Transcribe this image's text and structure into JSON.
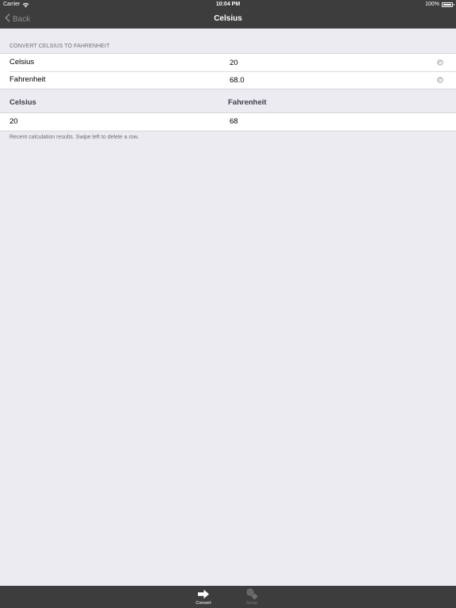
{
  "status_bar": {
    "carrier": "Carrier",
    "time": "10:04 PM",
    "battery": "100%"
  },
  "nav": {
    "back_label": "Back",
    "title": "Celsius"
  },
  "converter": {
    "section_header": "CONVERT CELSIUS TO FAHRENHEIT",
    "rows": [
      {
        "label": "Celsius",
        "value": "20"
      },
      {
        "label": "Fahrenheit",
        "value": "68.0"
      }
    ]
  },
  "results": {
    "headers": [
      "Celsius",
      "Fahrenheit"
    ],
    "rows": [
      {
        "celsius": "20",
        "fahrenheit": "68"
      }
    ],
    "footer_note": "Recent calculation results.  Swipe left to delete a row."
  },
  "tab_bar": {
    "tabs": [
      {
        "label": "Convert",
        "icon": "arrow-right-icon",
        "selected": true
      },
      {
        "label": "Setup",
        "icon": "gears-icon",
        "selected": false
      }
    ]
  },
  "colors": {
    "bar_background": "#3d3d3d",
    "page_background": "#ebebf1",
    "secondary_text": "#6d6d72"
  }
}
